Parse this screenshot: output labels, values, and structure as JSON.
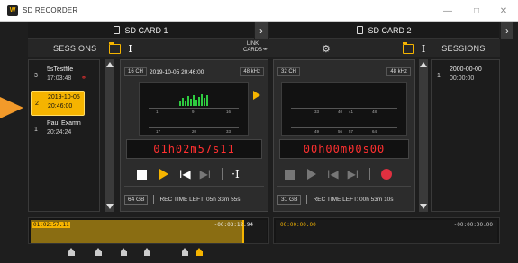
{
  "window": {
    "title": "SD RECORDER",
    "app_icon": "W"
  },
  "accent": "#f5b400",
  "card1": {
    "title": "SD CARD 1",
    "sessions_label": "SESSIONS",
    "sessions": [
      {
        "num": "3",
        "name": "5sTestfile",
        "time": "17:03:48",
        "linked": true
      },
      {
        "num": "2",
        "name": "2019-10-05",
        "time": "20:46:00",
        "selected": true
      },
      {
        "num": "1",
        "name": "Paul Examn",
        "time": "20:24:24"
      }
    ],
    "channels": "16 CH",
    "datetime": "2019-10-05 20:46:00",
    "samplerate": "48 kHz",
    "timecode": {
      "h": "01",
      "m": "02",
      "s": "57",
      "f": "11"
    },
    "storage": "64 GB",
    "rec_time_left": "REC TIME LEFT:   05h 33m 55s",
    "meter_scale_top": [
      "1",
      "9",
      "16"
    ],
    "meter_scale_bottom": [
      "17",
      "20",
      "33"
    ],
    "timeline": {
      "start": "01:02:57.11",
      "end": "-00:03:12.94",
      "progress": 0.9
    }
  },
  "link_cards": {
    "line1": "LINK",
    "line2": "CARDS"
  },
  "card2": {
    "title": "SD CARD 2",
    "sessions_label": "SESSIONS",
    "sessions": [
      {
        "num": "1",
        "name": "2000-00-00",
        "time": "00:00:00"
      }
    ],
    "channels": "32 CH",
    "samplerate": "48 kHz",
    "timecode": {
      "h": "00",
      "m": "00",
      "s": "00",
      "f": "00"
    },
    "storage": "31 GB",
    "rec_time_left": "REC TIME LEFT:   00h 53m 10s",
    "meter_scale_top": [
      "33",
      "40",
      "41",
      "48"
    ],
    "meter_scale_bottom": [
      "49",
      "56",
      "57",
      "64"
    ],
    "timeline": {
      "start": "00:00:00.00",
      "end": "-00:00:00.00"
    }
  }
}
